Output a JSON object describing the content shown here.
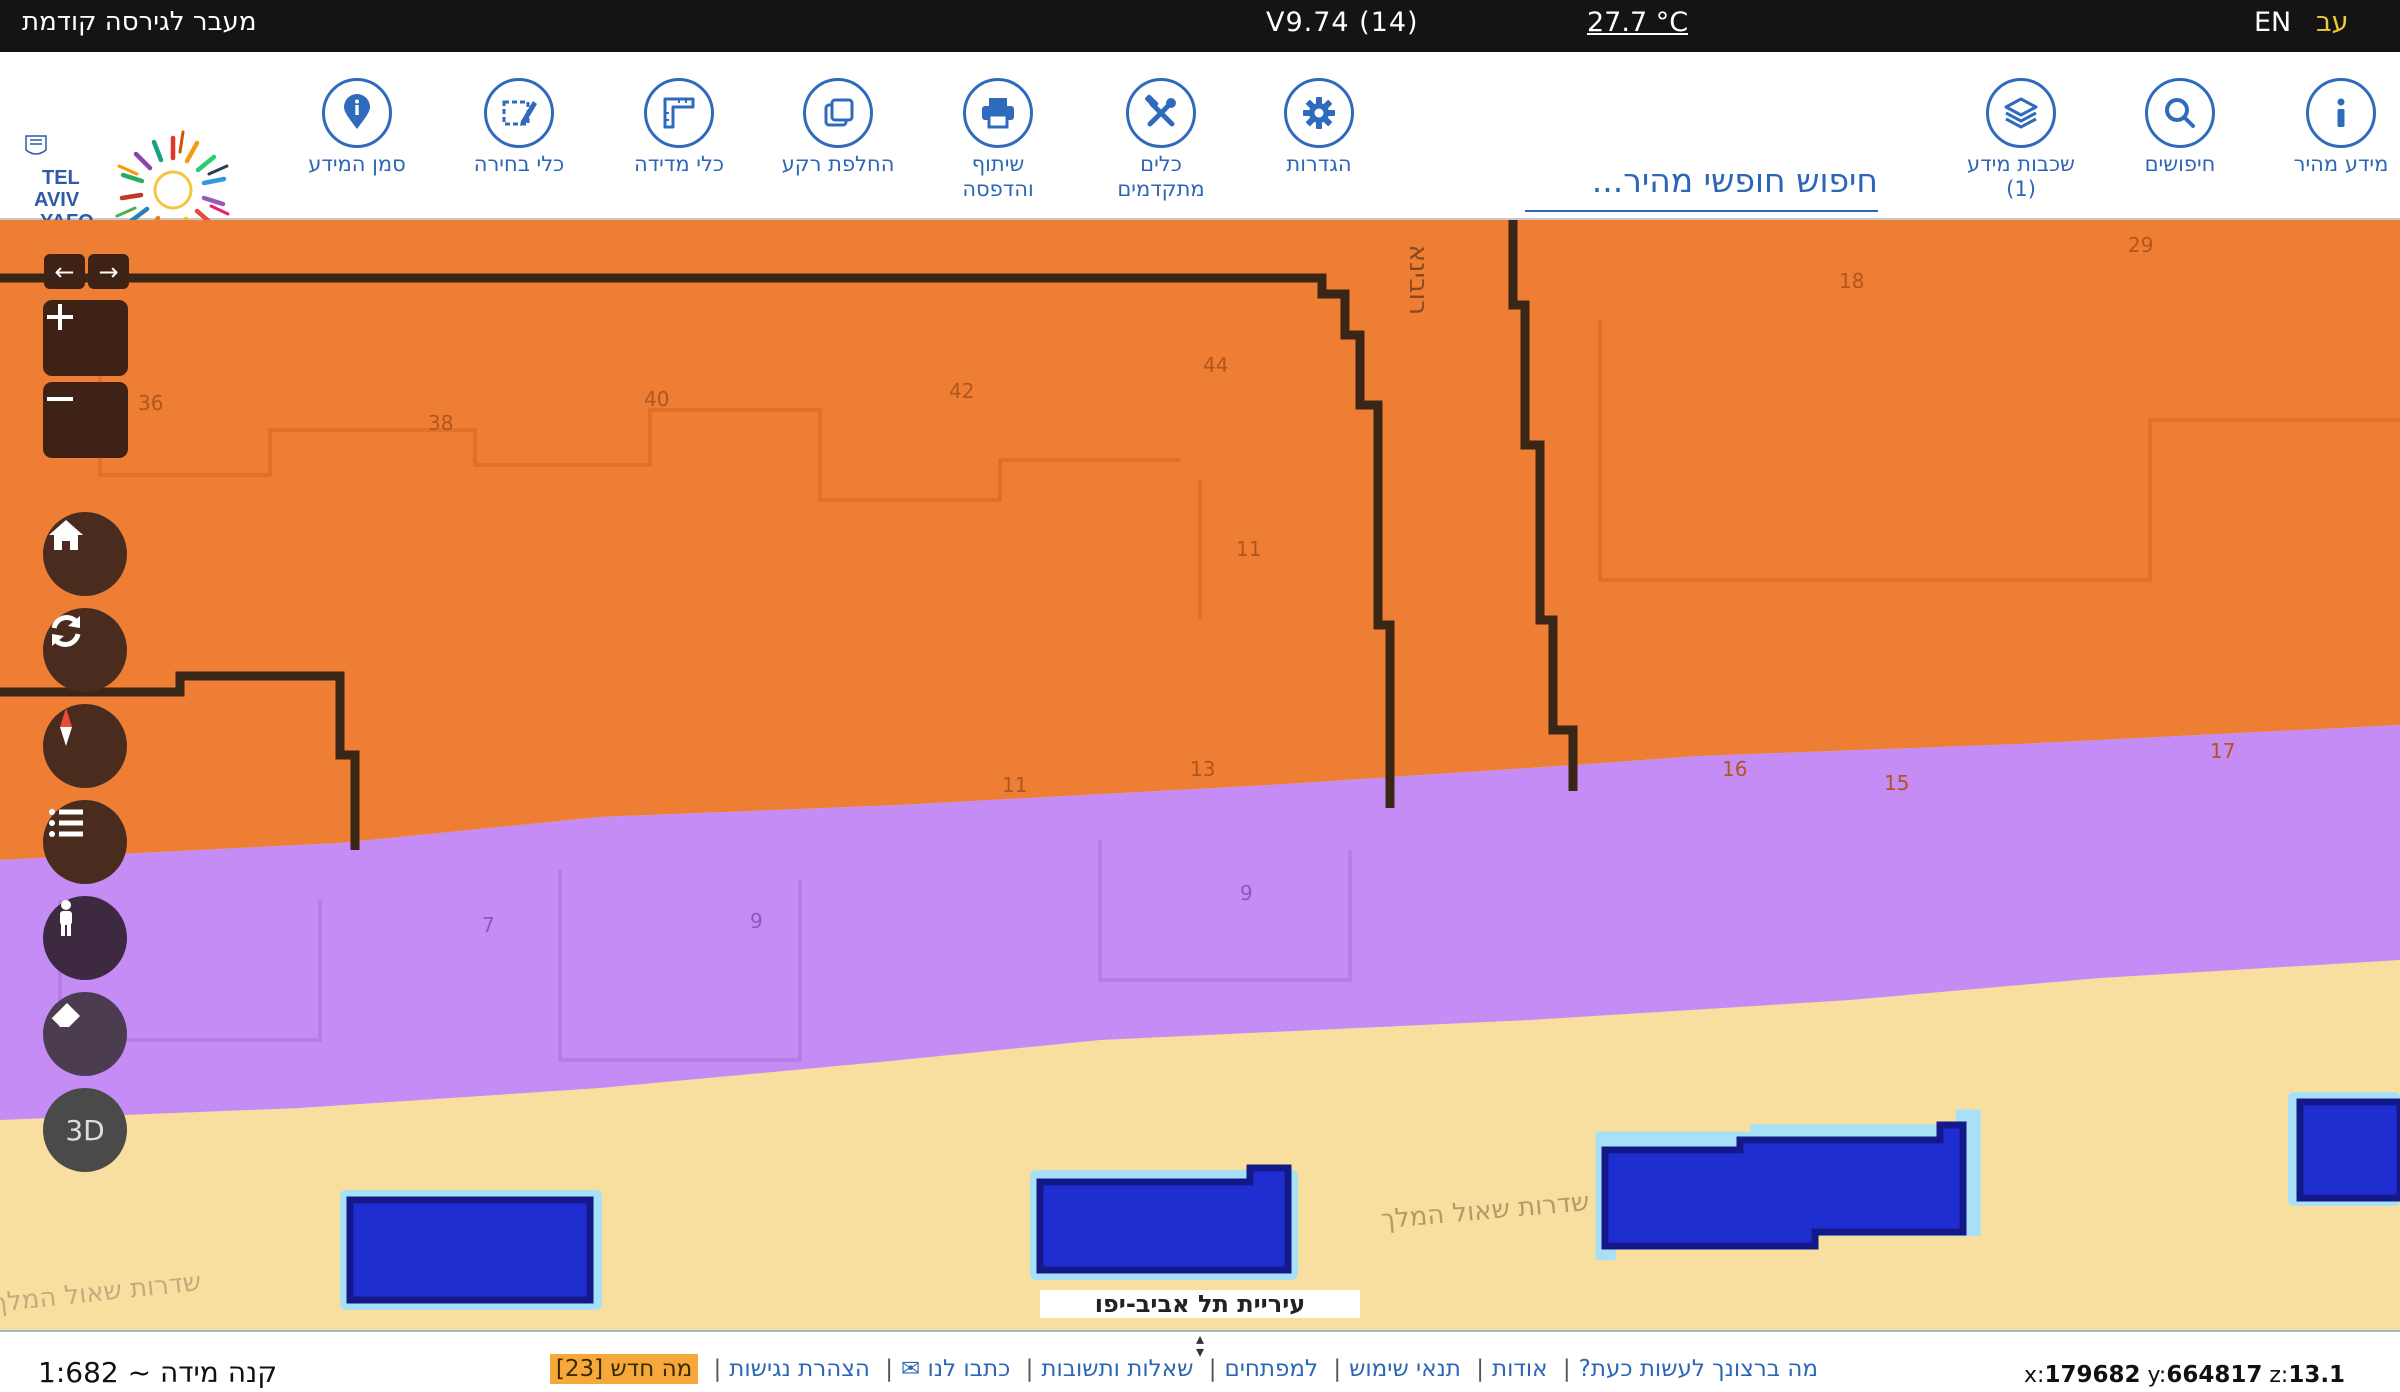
{
  "topbar": {
    "prev_version": "מעבר לגירסה קודמת",
    "version": "V9.74 (14)",
    "temperature": "27.7 °C",
    "lang_en": "EN",
    "lang_he": "עב"
  },
  "toolbar": {
    "tools": [
      {
        "label": "מידע מהיר",
        "icon": "info-icon"
      },
      {
        "label": "חיפושים",
        "icon": "search-icon"
      },
      {
        "label": "שכבות מידע (1)",
        "icon": "layers-icon"
      },
      {
        "label": "הגדרות",
        "icon": "gear-icon"
      },
      {
        "label": "כלים מתקדמים",
        "icon": "tools-icon"
      },
      {
        "label": "שיתוף והדפסה",
        "icon": "printer-icon"
      },
      {
        "label": "החלפת רקע",
        "icon": "basemap-icon"
      },
      {
        "label": "כלי מדידה",
        "icon": "ruler-icon"
      },
      {
        "label": "כלי בחירה",
        "icon": "select-icon"
      },
      {
        "label": "סמן המידע",
        "icon": "pin-icon"
      }
    ],
    "search_placeholder": "חיפוש חופשי מהיר..."
  },
  "logo": {
    "text_tel": "TEL",
    "text_aviv": "AVIV",
    "text_yafo": "YAFO",
    "icon": "tel-aviv-yafo-logo"
  },
  "map": {
    "colors": {
      "residential": "#ee7e33",
      "road": "#c58cf6",
      "public": "#f8dfa0",
      "water": "#1f2ed1"
    },
    "house_numbers": [
      "36",
      "38",
      "40",
      "42",
      "44",
      "18",
      "29",
      "11",
      "16",
      "15",
      "17",
      "11",
      "13",
      "7",
      "9",
      "9"
    ],
    "street_labels": [
      "רובינא",
      "שדרות שאול המלך",
      "שדרות שאול המלך"
    ],
    "city_label": "עיריית תל אביב-יפו",
    "controls": [
      "arrow-left-icon",
      "arrow-right-icon",
      "zoom-in-icon",
      "zoom-out-icon",
      "home-icon",
      "refresh-icon",
      "compass-icon",
      "list-icon",
      "person-icon",
      "eraser-icon"
    ],
    "btn_3d": "3D"
  },
  "footer": {
    "scale_text": "קנה מידה ~ 1:682",
    "links": [
      "מה ברצונך לעשות כעת?",
      "אודות",
      "תנאי שימוש",
      "למפתחים",
      "שאלות ותשובות",
      "כתבו לנו ✉",
      "הצהרת נגישות"
    ],
    "whats_new": "מה חדש [23]",
    "coords": {
      "x_label": "x:",
      "x": "179682",
      "y_label": "y:",
      "y": "664817",
      "z_label": "z:",
      "z": "13.1"
    }
  }
}
